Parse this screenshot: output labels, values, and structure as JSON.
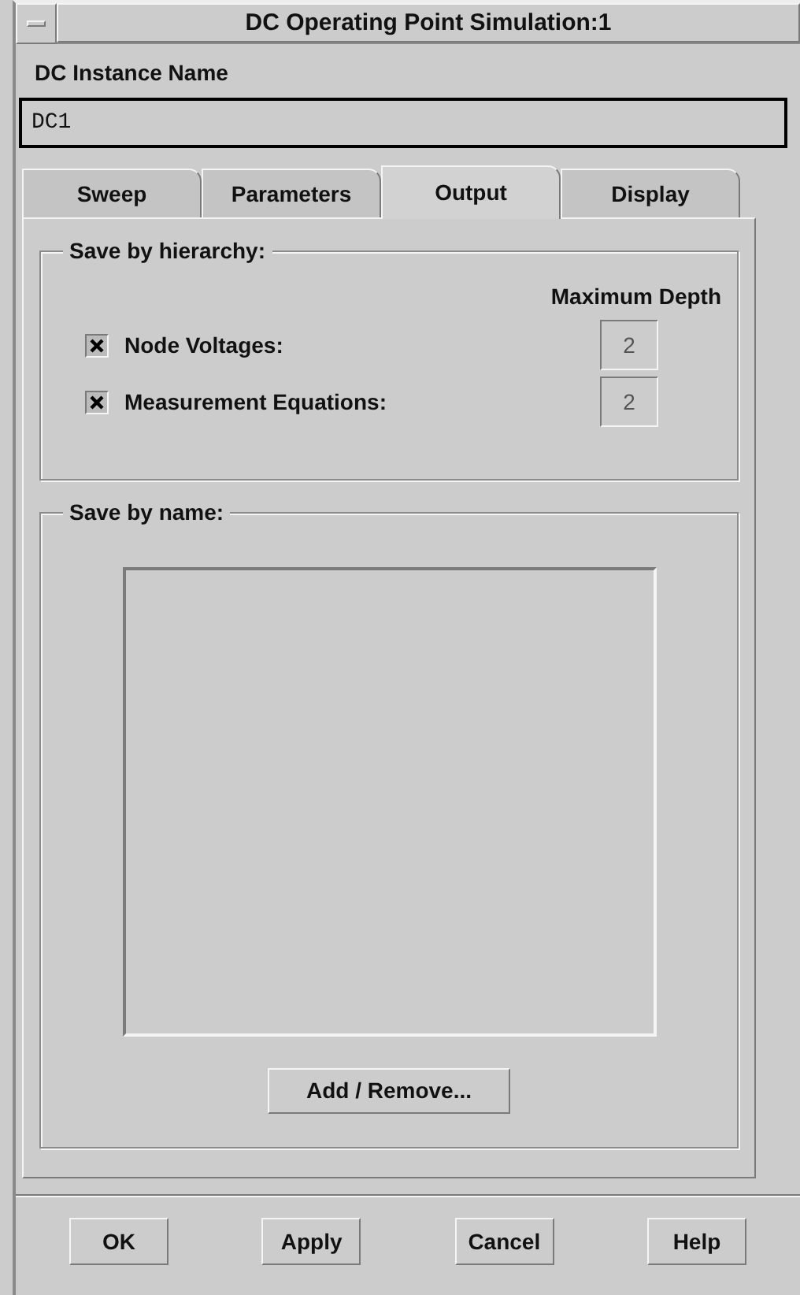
{
  "window": {
    "title": "DC Operating Point Simulation:1"
  },
  "instance_name": {
    "label": "DC Instance Name",
    "value": "DC1"
  },
  "tabs": [
    {
      "label": "Sweep",
      "selected": false
    },
    {
      "label": "Parameters",
      "selected": false
    },
    {
      "label": "Output",
      "selected": true
    },
    {
      "label": "Display",
      "selected": false
    }
  ],
  "save_by_hierarchy": {
    "title": "Save by hierarchy:",
    "column_heading": "Maximum Depth",
    "rows": [
      {
        "label": "Node Voltages:",
        "checked": true,
        "depth": "2"
      },
      {
        "label": "Measurement Equations:",
        "checked": true,
        "depth": "2"
      }
    ]
  },
  "save_by_name": {
    "title": "Save by name:",
    "button": "Add / Remove..."
  },
  "buttons": [
    "OK",
    "Apply",
    "Cancel",
    "Help"
  ]
}
